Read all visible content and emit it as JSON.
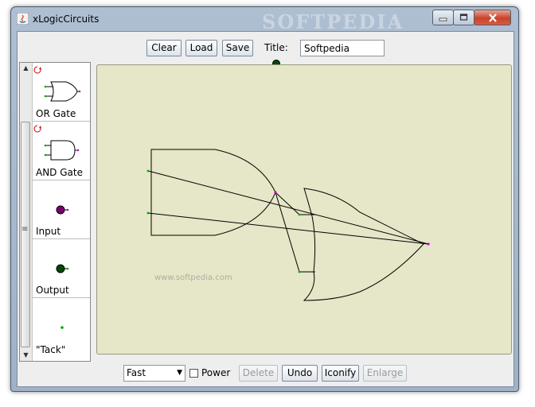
{
  "window": {
    "title": "xLogicCircuits",
    "watermark": "SOFTPEDIA"
  },
  "toolbar": {
    "clear_label": "Clear",
    "load_label": "Load",
    "save_label": "Save",
    "title_label": "Title:",
    "title_value": "Softpedia"
  },
  "palette": {
    "items": [
      {
        "label": "OR Gate",
        "icon": "or-gate-icon"
      },
      {
        "label": "AND Gate",
        "icon": "and-gate-icon"
      },
      {
        "label": "Input",
        "icon": "input-node-icon"
      },
      {
        "label": "Output",
        "icon": "output-node-icon"
      },
      {
        "label": "\"Tack\"",
        "icon": "tack-icon"
      }
    ]
  },
  "canvas": {
    "watermark": "www.softpedia.com",
    "colors": {
      "background": "#e6e6c8",
      "wire": "#000000",
      "connector_in": "#00aa00",
      "connector_out": "#cc00cc"
    }
  },
  "bottom": {
    "speed_value": "Fast",
    "power_label": "Power",
    "power_checked": false,
    "delete_label": "Delete",
    "undo_label": "Undo",
    "iconify_label": "Iconify",
    "enlarge_label": "Enlarge"
  }
}
